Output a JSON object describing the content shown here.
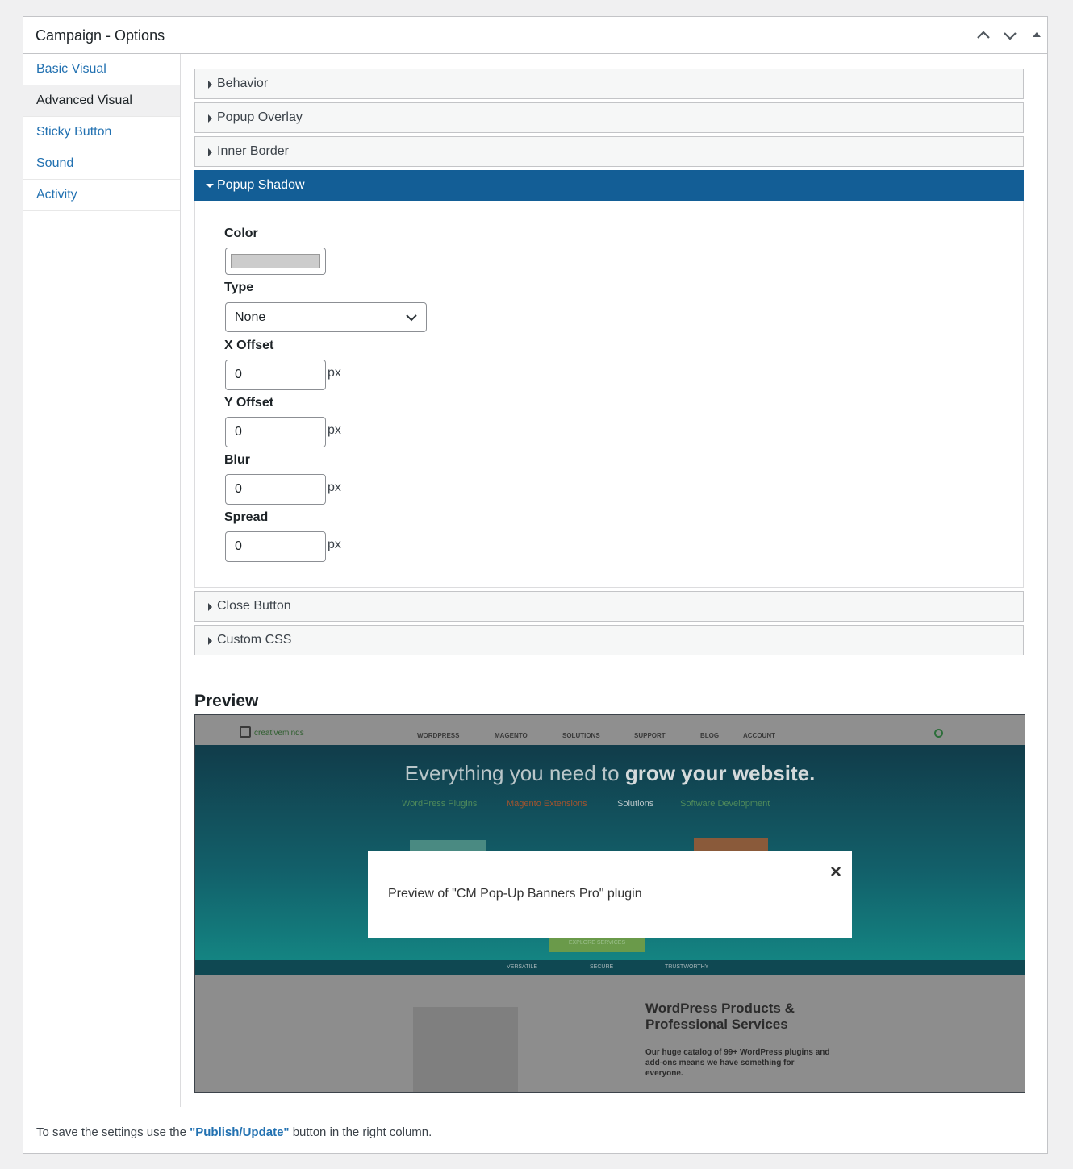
{
  "header": {
    "title": "Campaign - Options"
  },
  "sidebar": {
    "items": [
      {
        "label": "Basic Visual"
      },
      {
        "label": "Advanced Visual"
      },
      {
        "label": "Sticky Button"
      },
      {
        "label": "Sound"
      },
      {
        "label": "Activity"
      }
    ]
  },
  "sections": {
    "behavior": "Behavior",
    "popup_overlay": "Popup Overlay",
    "inner_border": "Inner Border",
    "popup_shadow": "Popup Shadow",
    "close_button": "Close Button",
    "custom_css": "Custom CSS"
  },
  "shadow": {
    "color_label": "Color",
    "color_value": "#cccccc",
    "type_label": "Type",
    "type_value": "None",
    "x_offset_label": "X Offset",
    "x_offset_value": "0",
    "y_offset_label": "Y Offset",
    "y_offset_value": "0",
    "blur_label": "Blur",
    "blur_value": "0",
    "spread_label": "Spread",
    "spread_value": "0",
    "unit": "px"
  },
  "preview": {
    "title": "Preview",
    "site": {
      "logo": "creativeminds",
      "nav": [
        "WORDPRESS",
        "MAGENTO",
        "SOLUTIONS",
        "SUPPORT",
        "BLOG",
        "ACCOUNT"
      ],
      "headline_light": "Everything you need to",
      "headline_bold": "grow your website.",
      "links": [
        "WordPress Plugins",
        "Magento Extensions",
        "Solutions",
        "Software Development"
      ],
      "cta": "EXPLORE SERVICES",
      "values": [
        "VERSATILE",
        "SECURE",
        "TRUSTWORTHY"
      ],
      "section_title": "WordPress Products & Professional Services",
      "section_text": "Our huge catalog of 99+ WordPress plugins and add-ons means we have something for everyone."
    },
    "popup_message": "Preview of \"CM Pop-Up Banners Pro\" plugin",
    "popup_close": "×"
  },
  "footer": {
    "prefix": "To save the settings use the ",
    "link": "\"Publish/Update\"",
    "suffix": " button in the right column."
  }
}
